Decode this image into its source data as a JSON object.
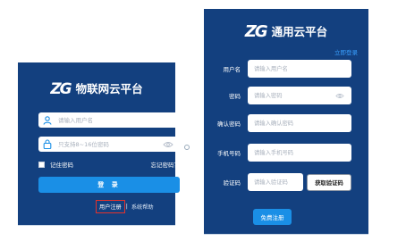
{
  "login": {
    "logo_mark": "ZG",
    "title": "物联网云平台",
    "username_placeholder": "请输入用户名",
    "password_placeholder": "只支持8~16位密码",
    "remember_label": "记住密码",
    "forgot_label": "忘记密码？",
    "login_button": "登 录",
    "register_link": "用户注册",
    "separator": "|",
    "help_link": "系统帮助"
  },
  "register": {
    "logo_mark": "ZG",
    "title": "通用云平台",
    "login_link": "立即登录",
    "username_label": "用户名",
    "username_placeholder": "请输入用户名",
    "password_label": "密码",
    "password_placeholder": "请输入密码",
    "confirm_label": "确认密码",
    "confirm_placeholder": "请输入确认密码",
    "phone_label": "手机号码",
    "phone_placeholder": "请输入手机号码",
    "code_label": "验证码",
    "code_placeholder": "请输入验证码",
    "get_code_button": "获取验证码",
    "submit_button": "免费注册"
  },
  "colors": {
    "panel_bg": "#13407f",
    "accent": "#1a8fe6",
    "highlight_border": "#e5322b"
  }
}
